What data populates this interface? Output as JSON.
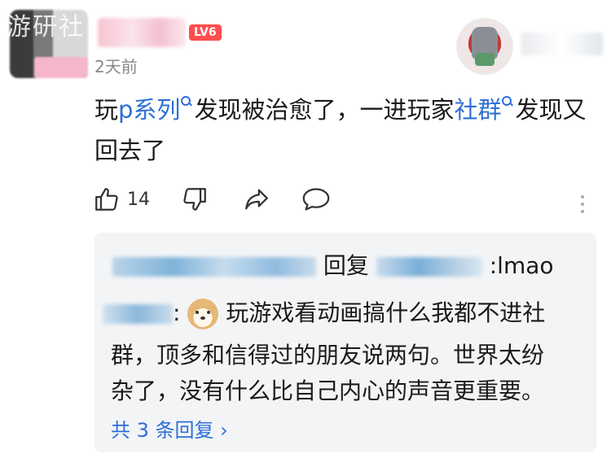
{
  "watermark": "游研社",
  "comment": {
    "author": {
      "level_badge": "LV6"
    },
    "timestamp": "2天前",
    "text_parts": [
      "玩",
      "p系列",
      "发现被治愈了，一进玩家",
      "社群",
      "发现又回去了"
    ],
    "actions": {
      "like_count": "14"
    }
  },
  "reply": {
    "reply_label": "回复",
    "reply_text": ":lmao",
    "colon": ":",
    "text": "玩游戏看动画搞什么我都不进社群，顶多和信得过的朋友说两句。世界太纷杂了，没有什么比自己内心的声音更重要。",
    "text_lines": [
      "玩游戏看动画搞什么我都不进社",
      "群，顶多和信得过的朋友说两句。世界太纷",
      "杂了，没有什么比自己内心的声音更重要。"
    ],
    "more_replies": "共 3 条回复 ›"
  },
  "icons": [
    "search-icon",
    "like-icon",
    "dislike-icon",
    "share-icon",
    "comment-icon",
    "more-icon",
    "chevron-right-icon"
  ],
  "colors": {
    "link": "#2c6fd6",
    "level_badge": "#ff4d4f",
    "reply_bg": "#f3f4f6"
  }
}
